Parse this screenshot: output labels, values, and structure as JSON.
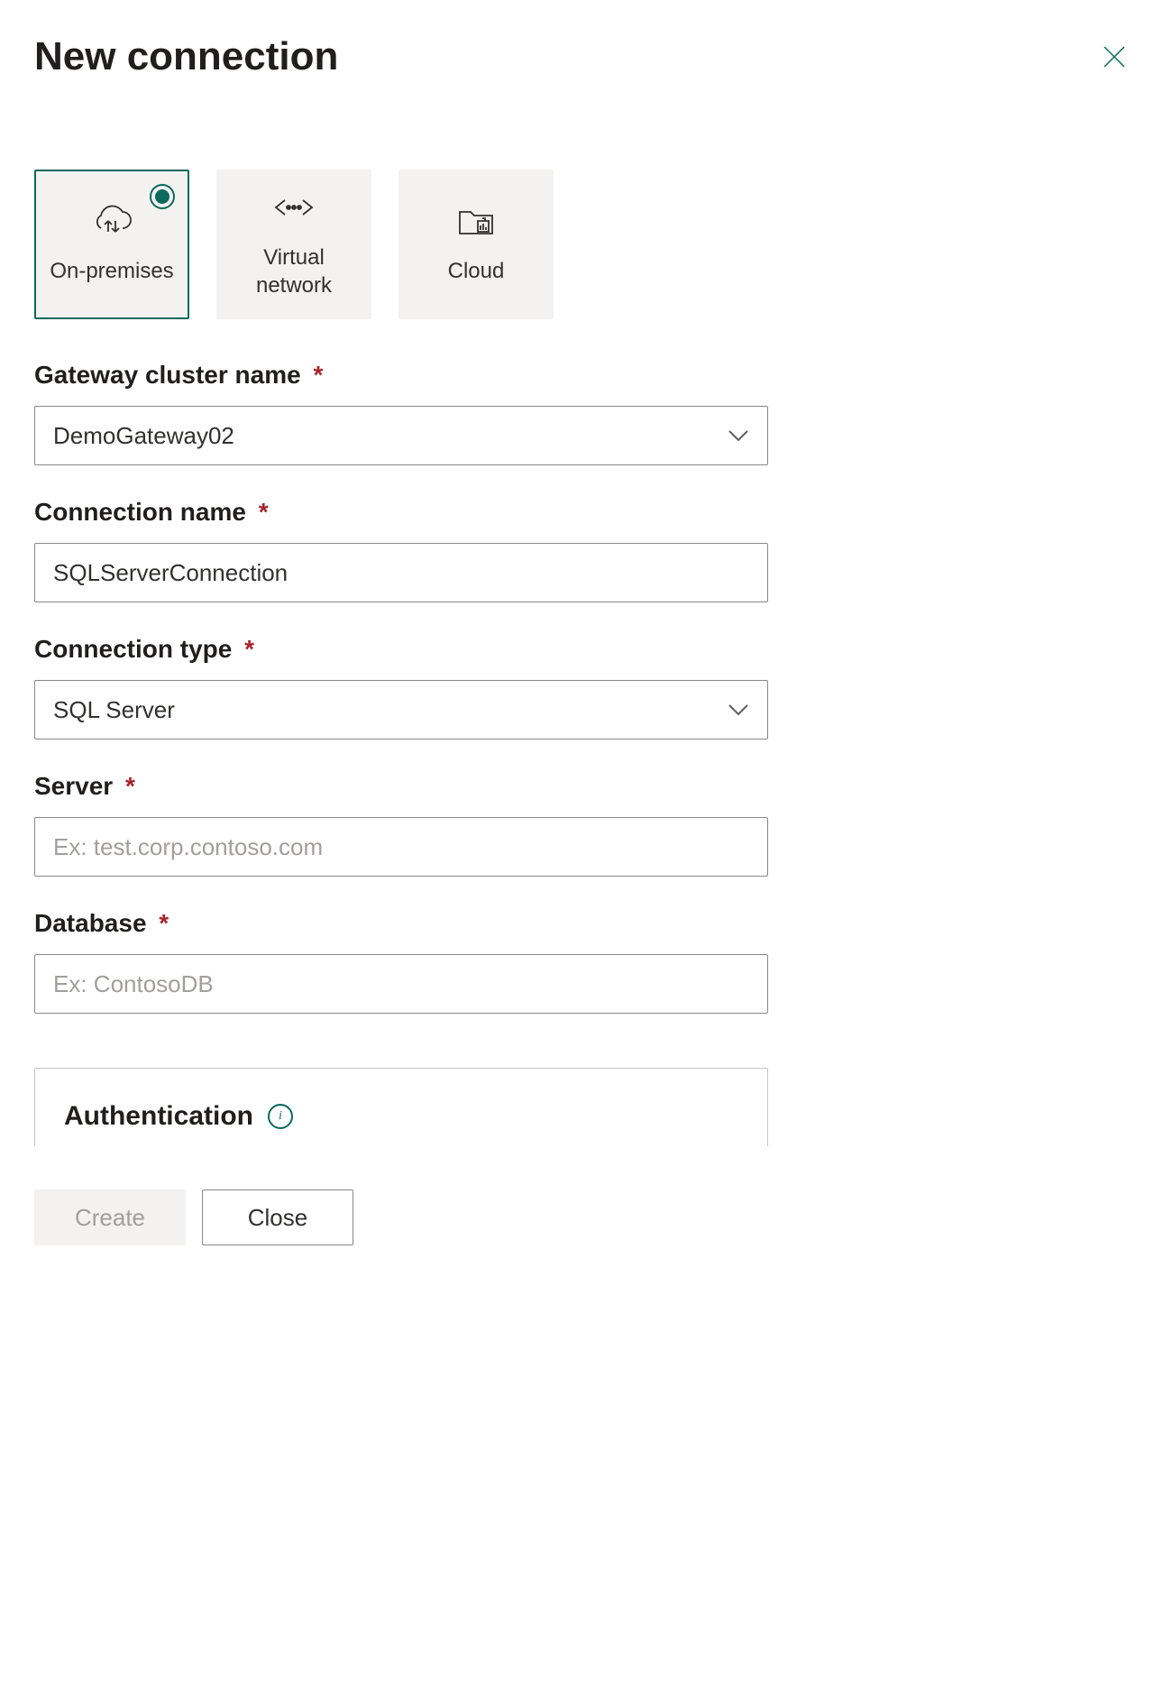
{
  "header": {
    "title": "New connection"
  },
  "types": {
    "on_premises": "On-premises",
    "virtual_network": "Virtual network",
    "cloud": "Cloud"
  },
  "fields": {
    "gateway": {
      "label": "Gateway cluster name",
      "value": "DemoGateway02"
    },
    "connection_name": {
      "label": "Connection name",
      "value": "SQLServerConnection"
    },
    "connection_type": {
      "label": "Connection type",
      "value": "SQL Server"
    },
    "server": {
      "label": "Server",
      "value": "",
      "placeholder": "Ex: test.corp.contoso.com"
    },
    "database": {
      "label": "Database",
      "value": "",
      "placeholder": "Ex: ContosoDB"
    }
  },
  "auth": {
    "title": "Authentication"
  },
  "footer": {
    "create": "Create",
    "close": "Close"
  },
  "required_mark": "*"
}
